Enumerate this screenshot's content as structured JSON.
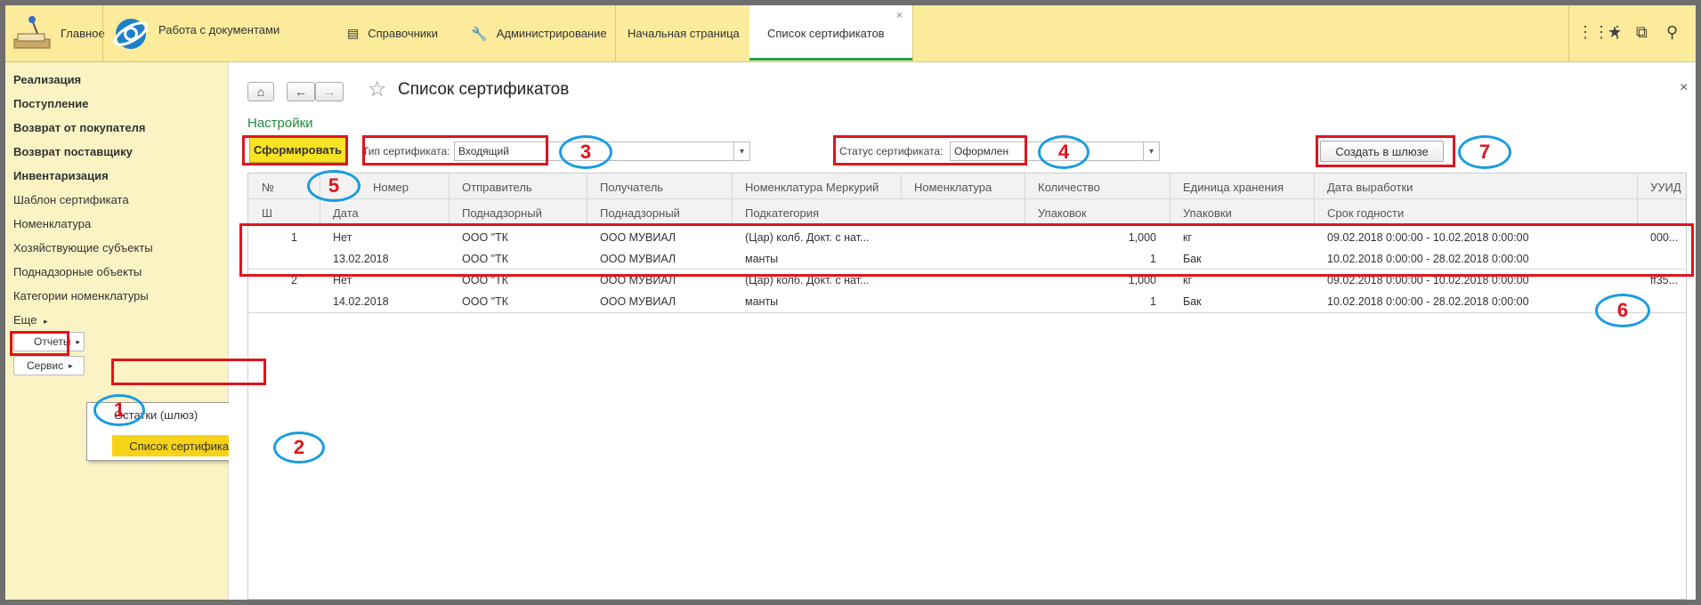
{
  "topbar": {
    "home": "Главное",
    "docs": "Работа с документами",
    "refs": "Справочники",
    "admin": "Администрирование",
    "tab_start": "Начальная страница",
    "tab_list": "Список сертификатов",
    "tab_close": "×"
  },
  "sidebar": {
    "items": [
      "Реализация",
      "Поступление",
      "Возврат от покупателя",
      "Возврат поставщику",
      "Инвентаризация",
      "Шаблон сертификата",
      "Номенклатура",
      "Хозяйствующие субъекты",
      "Поднадзорные объекты",
      "Категории номенклатуры",
      "Еще"
    ],
    "reports": "Отчеты",
    "service": "Сервис",
    "popup_item1": "Остатки (шлюз)",
    "popup_item2": "Список сертификатов",
    "arrow": "▸"
  },
  "main": {
    "title": "Список сертификатов",
    "close": "×",
    "settings": "Настройки",
    "generate": "Сформировать",
    "cert_type_label": "Тип сертификата:",
    "cert_type_value": "Входящий",
    "status_label": "Статус сертификата:",
    "status_value": "Оформлен",
    "create_btn": "Создать в шлюзе"
  },
  "table": {
    "header1": [
      "№",
      "Номер",
      "Отправитель",
      "Получатель",
      "Номенклатура Меркурий",
      "Номенклатура",
      "Количество",
      "Единица хранения",
      "Дата выработки",
      "УУИД"
    ],
    "header2": [
      "Ш",
      "Дата",
      "Поднадзорный",
      "Поднадзорный",
      "Подкатегория",
      "Упаковок",
      "Упаковки",
      "Срок годности"
    ],
    "rows": [
      {
        "num": "1",
        "number": "Нет",
        "sender": "ООО \"ТК",
        "receiver": "ООО МУВИАЛ",
        "merc": "(Цар) колб. Докт. с нат...",
        "qty": "1,000",
        "unit": "кг",
        "prod_date": "09.02.2018 0:00:00 - 10.02.2018 0:00:00",
        "uuid": "000...",
        "date": "13.02.2018",
        "sender2": "ООО \"ТК",
        "receiver2": "ООО МУВИАЛ",
        "subcat": "манты",
        "packs": "1",
        "pack": "Бак",
        "expiry": "10.02.2018 0:00:00 - 28.02.2018 0:00:00"
      },
      {
        "num": "2",
        "number": "Нет",
        "sender": "ООО \"ТК",
        "receiver": "ООО МУВИАЛ",
        "merc": "(Цар) колб. Докт. с нат...",
        "qty": "1,000",
        "unit": "кг",
        "prod_date": "09.02.2018 0:00:00 - 10.02.2018 0:00:00",
        "uuid": "ff35...",
        "date": "14.02.2018",
        "sender2": "ООО \"ТК",
        "receiver2": "ООО МУВИАЛ",
        "subcat": "манты",
        "packs": "1",
        "pack": "Бак",
        "expiry": "10.02.2018 0:00:00 - 28.02.2018 0:00:00"
      }
    ]
  },
  "callouts": [
    "1",
    "2",
    "3",
    "4",
    "5",
    "6",
    "7"
  ],
  "colors": {
    "accent_yellow": "#fbeb9b",
    "sidebar": "#fbf3c4",
    "button_yellow": "#f7e224",
    "annot_red": "#e0141e",
    "annot_blue": "#1a9ce0",
    "settings_green": "#1f8c3a"
  }
}
